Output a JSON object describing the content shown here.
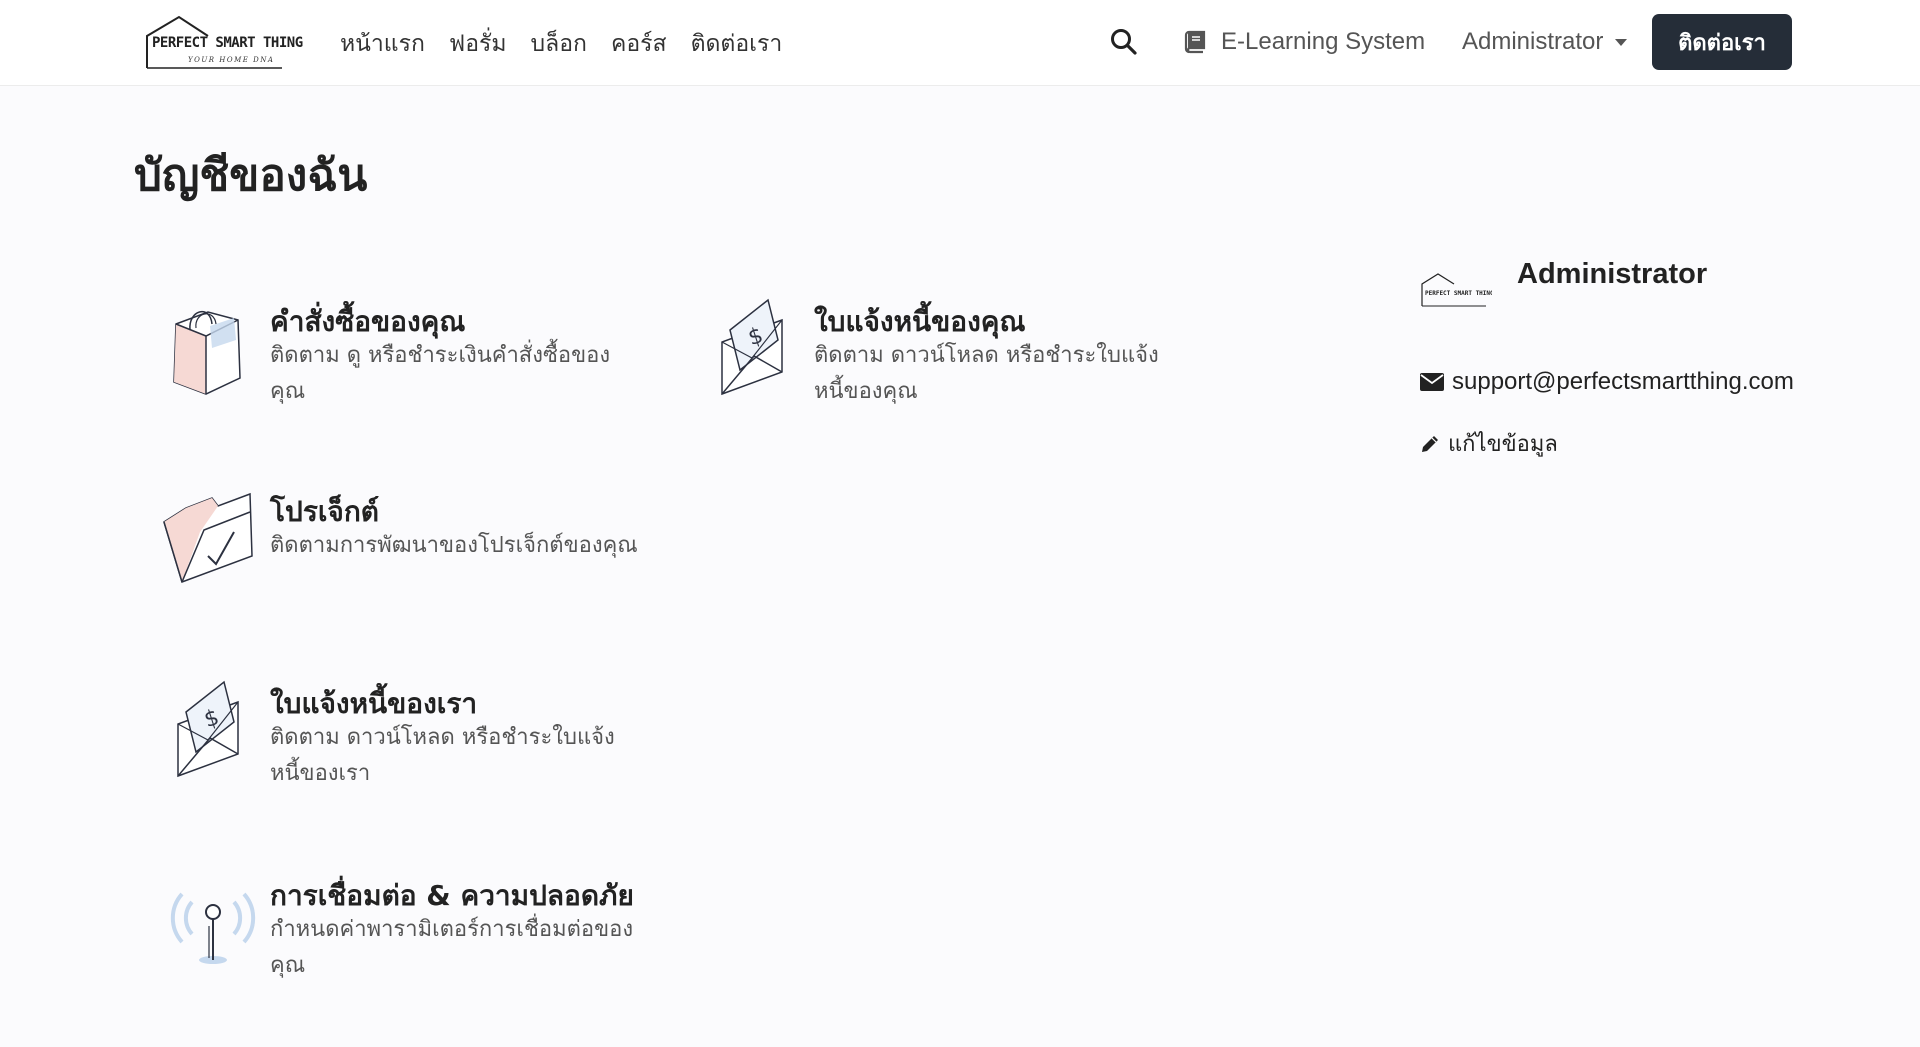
{
  "header": {
    "logo_text": "PERFECT SMART THING",
    "logo_tagline": "YOUR HOME DNA",
    "nav": [
      "หน้าแรก",
      "ฟอรั่ม",
      "บล็อก",
      "คอร์ส",
      "ติดต่อเรา"
    ],
    "search_icon": "search-icon",
    "elearning_label": "E-Learning System",
    "elearning_icon": "book-icon",
    "user_menu_label": "Administrator",
    "contact_button": "ติดต่อเรา"
  },
  "page": {
    "title": "บัญชีของฉัน"
  },
  "cards": [
    {
      "title": "คำสั่งซื้อของคุณ",
      "desc": "ติดตาม ดู หรือชำระเงินคำสั่งซื้อของคุณ",
      "icon": "shopping-bag-icon"
    },
    {
      "title": "ใบแจ้งหนี้ของคุณ",
      "desc": "ติดตาม ดาวน์โหลด หรือชำระใบแจ้งหนี้ของคุณ",
      "icon": "invoice-envelope-icon"
    },
    {
      "title": "โปรเจ็กต์",
      "desc": "ติดตามการพัฒนาของโปรเจ็กต์ของคุณ",
      "icon": "folder-check-icon"
    },
    {
      "title": "ใบแจ้งหนี้ของเรา",
      "desc": "ติดตาม ดาวน์โหลด หรือชำระใบแจ้งหนี้ของเรา",
      "icon": "invoice-envelope-icon"
    },
    {
      "title": "การเชื่อมต่อ & ความปลอดภัย",
      "desc": "กำหนดค่าพารามิเตอร์การเชื่อมต่อของคุณ",
      "icon": "antenna-icon"
    }
  ],
  "profile": {
    "name": "Administrator",
    "email": "support@perfectsmartthing.com",
    "edit_label": "แก้ไขข้อมูล"
  },
  "colors": {
    "contact_button_bg": "#252d38",
    "icon_pink": "#f6d9d4",
    "icon_blue": "#c5d8ee"
  }
}
